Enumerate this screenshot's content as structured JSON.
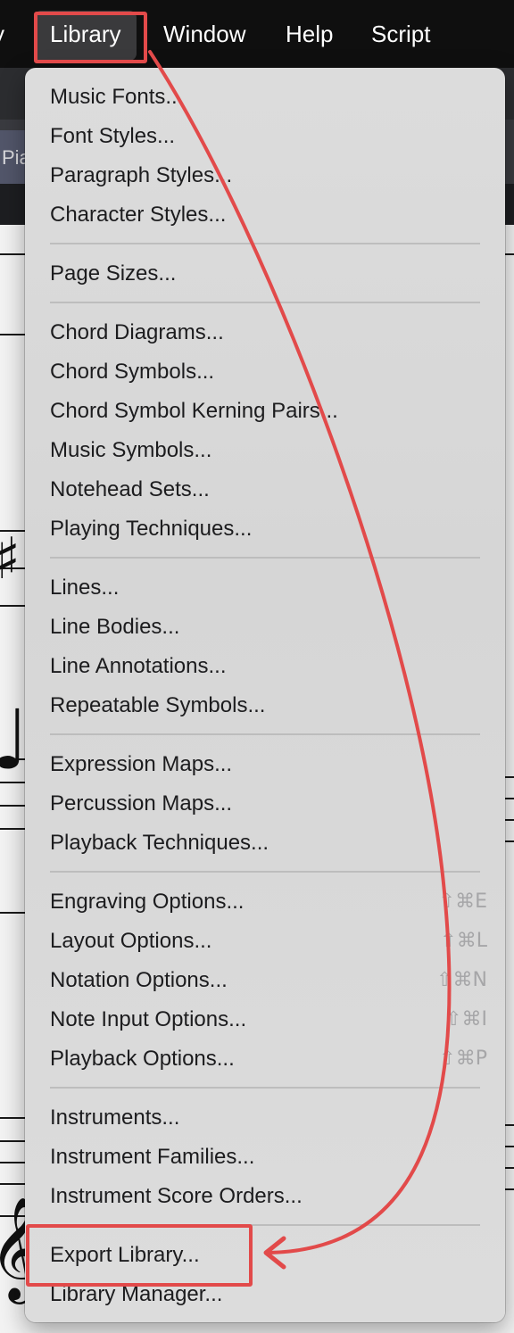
{
  "menubar": {
    "items": [
      {
        "label": "y"
      },
      {
        "label": "Library"
      },
      {
        "label": "Window"
      },
      {
        "label": "Help"
      },
      {
        "label": "Script"
      }
    ]
  },
  "background": {
    "tab_label": "Pia"
  },
  "library_menu": {
    "groups": [
      [
        "Music Fonts...",
        "Font Styles...",
        "Paragraph Styles...",
        "Character Styles..."
      ],
      [
        "Page Sizes..."
      ],
      [
        "Chord Diagrams...",
        "Chord Symbols...",
        "Chord Symbol Kerning Pairs...",
        "Music Symbols...",
        "Notehead Sets...",
        "Playing Techniques..."
      ],
      [
        "Lines...",
        "Line Bodies...",
        "Line Annotations...",
        "Repeatable Symbols..."
      ],
      [
        "Expression Maps...",
        "Percussion Maps...",
        "Playback Techniques..."
      ],
      [
        "Engraving Options...",
        "Layout Options...",
        "Notation Options...",
        "Note Input Options...",
        "Playback Options..."
      ],
      [
        "Instruments...",
        "Instrument Families...",
        "Instrument Score Orders..."
      ],
      [
        "Export Library...",
        "Library Manager..."
      ]
    ],
    "shortcuts": {
      "Engraving Options...": "⇧⌘E",
      "Layout Options...": "⇧⌘L",
      "Notation Options...": "⇧⌘N",
      "Note Input Options...": "⇧⌘I",
      "Playback Options...": "⇧⌘P"
    }
  },
  "annotation": {
    "color": "#e24a4a",
    "from": "Library",
    "to": "Export Library..."
  }
}
